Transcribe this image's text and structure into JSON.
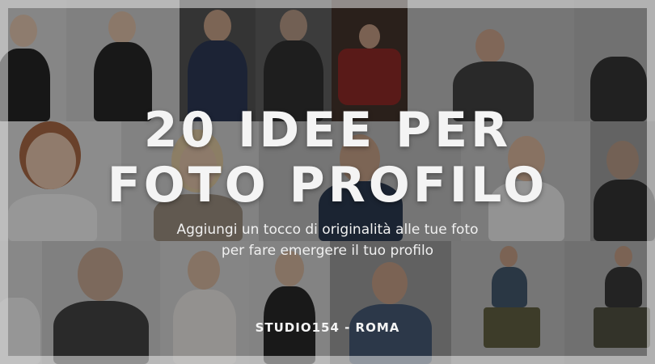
{
  "headline": {
    "line1": "20 IDEE PER",
    "line2": "FOTO PROFILO"
  },
  "subtitle": {
    "line1": "Aggiungi un tocco di originalità alle tue foto",
    "line2": "per fare emergere il tuo profilo"
  },
  "studio_label": "STUDIO154 - ROMA",
  "colors": {
    "overlay": "#141414",
    "text": "#f4f4f4",
    "frame": "#e6e6e6"
  }
}
